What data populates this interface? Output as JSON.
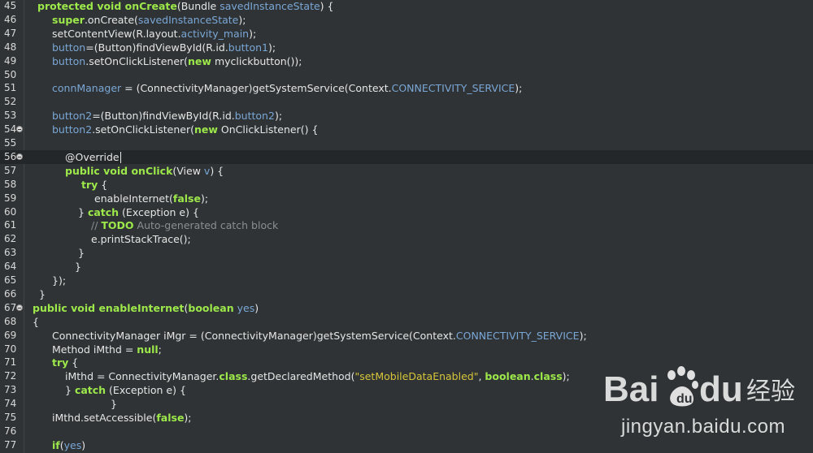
{
  "editor": {
    "current_line": "56",
    "lines": [
      {
        "num": "45",
        "fold": false,
        "indent": 16,
        "tokens": [
          {
            "t": "protected void ",
            "c": "kw"
          },
          {
            "t": "onCreate",
            "c": "kw"
          },
          {
            "t": "(Bundle ",
            "c": ""
          },
          {
            "t": "savedInstanceState",
            "c": "fld"
          },
          {
            "t": ") {",
            "c": ""
          }
        ]
      },
      {
        "num": "46",
        "fold": false,
        "indent": 34,
        "tokens": [
          {
            "t": "super",
            "c": "kw"
          },
          {
            "t": ".onCreate(",
            "c": ""
          },
          {
            "t": "savedInstanceState",
            "c": "fld"
          },
          {
            "t": ");",
            "c": ""
          }
        ]
      },
      {
        "num": "47",
        "fold": false,
        "indent": 34,
        "tokens": [
          {
            "t": "setContentView(R.layout.",
            "c": ""
          },
          {
            "t": "activity_main",
            "c": "fld"
          },
          {
            "t": ");",
            "c": ""
          }
        ]
      },
      {
        "num": "48",
        "fold": false,
        "indent": 34,
        "tokens": [
          {
            "t": "button",
            "c": "fld"
          },
          {
            "t": "=(Button)findViewById(R.id.",
            "c": ""
          },
          {
            "t": "button1",
            "c": "fld"
          },
          {
            "t": ");",
            "c": ""
          }
        ]
      },
      {
        "num": "49",
        "fold": false,
        "indent": 34,
        "tokens": [
          {
            "t": "button",
            "c": "fld"
          },
          {
            "t": ".setOnClickListener(",
            "c": ""
          },
          {
            "t": "new",
            "c": "kw"
          },
          {
            "t": " myclickbutton());",
            "c": ""
          }
        ]
      },
      {
        "num": "50",
        "fold": false,
        "indent": 34,
        "tokens": []
      },
      {
        "num": "51",
        "fold": false,
        "indent": 34,
        "tokens": [
          {
            "t": "connManager",
            "c": "fld"
          },
          {
            "t": " = (ConnectivityManager)getSystemService(Context.",
            "c": ""
          },
          {
            "t": "CONNECTIVITY_SERVICE",
            "c": "fld"
          },
          {
            "t": ");",
            "c": ""
          }
        ]
      },
      {
        "num": "52",
        "fold": false,
        "indent": 34,
        "tokens": []
      },
      {
        "num": "53",
        "fold": false,
        "indent": 34,
        "tokens": [
          {
            "t": "button2",
            "c": "fld"
          },
          {
            "t": "=(Button)findViewById(R.id.",
            "c": ""
          },
          {
            "t": "button2",
            "c": "fld"
          },
          {
            "t": ");",
            "c": ""
          }
        ]
      },
      {
        "num": "54",
        "fold": true,
        "indent": 34,
        "tokens": [
          {
            "t": "button2",
            "c": "fld"
          },
          {
            "t": ".setOnClickListener(",
            "c": ""
          },
          {
            "t": "new",
            "c": "kw"
          },
          {
            "t": " OnClickListener() {",
            "c": ""
          }
        ]
      },
      {
        "num": "55",
        "fold": false,
        "indent": 34,
        "tokens": []
      },
      {
        "num": "56",
        "fold": true,
        "indent": 50,
        "tokens": [
          {
            "t": "@Override",
            "c": "ann"
          }
        ]
      },
      {
        "num": "57",
        "fold": false,
        "indent": 50,
        "tokens": [
          {
            "t": "public void ",
            "c": "kw"
          },
          {
            "t": "onClick",
            "c": "kw"
          },
          {
            "t": "(View ",
            "c": ""
          },
          {
            "t": "v",
            "c": "fld"
          },
          {
            "t": ") {",
            "c": ""
          }
        ]
      },
      {
        "num": "58",
        "fold": false,
        "indent": 70,
        "tokens": [
          {
            "t": "try",
            "c": "kw"
          },
          {
            "t": " {",
            "c": ""
          }
        ]
      },
      {
        "num": "59",
        "fold": false,
        "indent": 86,
        "tokens": [
          {
            "t": "enableInternet(",
            "c": ""
          },
          {
            "t": "false",
            "c": "kw"
          },
          {
            "t": ");",
            "c": ""
          }
        ]
      },
      {
        "num": "60",
        "fold": false,
        "indent": 66,
        "tokens": [
          {
            "t": "} ",
            "c": ""
          },
          {
            "t": "catch",
            "c": "kw"
          },
          {
            "t": " (Exception e) {",
            "c": ""
          }
        ]
      },
      {
        "num": "61",
        "fold": false,
        "indent": 82,
        "tokens": [
          {
            "t": "// ",
            "c": "cm"
          },
          {
            "t": "TODO",
            "c": "todo"
          },
          {
            "t": " Auto-generated catch block",
            "c": "cm"
          }
        ]
      },
      {
        "num": "62",
        "fold": false,
        "indent": 82,
        "tokens": [
          {
            "t": "e.printStackTrace();",
            "c": ""
          }
        ]
      },
      {
        "num": "63",
        "fold": false,
        "indent": 66,
        "tokens": [
          {
            "t": "}",
            "c": ""
          }
        ]
      },
      {
        "num": "64",
        "fold": false,
        "indent": 62,
        "tokens": [
          {
            "t": "}",
            "c": ""
          }
        ]
      },
      {
        "num": "65",
        "fold": false,
        "indent": 34,
        "tokens": [
          {
            "t": "});",
            "c": ""
          }
        ]
      },
      {
        "num": "66",
        "fold": false,
        "indent": 18,
        "tokens": [
          {
            "t": "}",
            "c": ""
          }
        ]
      },
      {
        "num": "67",
        "fold": true,
        "indent": 10,
        "tokens": [
          {
            "t": "public void ",
            "c": "kw"
          },
          {
            "t": "enableInternet",
            "c": "kw"
          },
          {
            "t": "(",
            "c": ""
          },
          {
            "t": "boolean",
            "c": "kw"
          },
          {
            "t": " ",
            "c": ""
          },
          {
            "t": "yes",
            "c": "fld"
          },
          {
            "t": ")",
            "c": ""
          }
        ]
      },
      {
        "num": "68",
        "fold": false,
        "indent": 10,
        "tokens": [
          {
            "t": "{",
            "c": ""
          }
        ]
      },
      {
        "num": "69",
        "fold": false,
        "indent": 34,
        "tokens": [
          {
            "t": "ConnectivityManager iMgr = (ConnectivityManager)getSystemService(Context.",
            "c": ""
          },
          {
            "t": "CONNECTIVITY_SERVICE",
            "c": "fld"
          },
          {
            "t": ");",
            "c": ""
          }
        ]
      },
      {
        "num": "70",
        "fold": false,
        "indent": 34,
        "tokens": [
          {
            "t": "Method iMthd = ",
            "c": ""
          },
          {
            "t": "null",
            "c": "kw"
          },
          {
            "t": ";",
            "c": ""
          }
        ]
      },
      {
        "num": "71",
        "fold": false,
        "indent": 34,
        "tokens": [
          {
            "t": "try",
            "c": "kw"
          },
          {
            "t": " {",
            "c": ""
          }
        ]
      },
      {
        "num": "72",
        "fold": false,
        "indent": 50,
        "tokens": [
          {
            "t": "iMthd = ConnectivityManager.",
            "c": ""
          },
          {
            "t": "class",
            "c": "kw"
          },
          {
            "t": ".getDeclaredMethod(",
            "c": ""
          },
          {
            "t": "\"setMobileDataEnabled\"",
            "c": "str"
          },
          {
            "t": ", ",
            "c": ""
          },
          {
            "t": "boolean",
            "c": "kw"
          },
          {
            "t": ".",
            "c": ""
          },
          {
            "t": "class",
            "c": "kw"
          },
          {
            "t": ");",
            "c": ""
          }
        ]
      },
      {
        "num": "73",
        "fold": false,
        "indent": 50,
        "tokens": [
          {
            "t": "} ",
            "c": ""
          },
          {
            "t": "catch",
            "c": "kw"
          },
          {
            "t": " (Exception e) {",
            "c": ""
          }
        ]
      },
      {
        "num": "74",
        "fold": false,
        "indent": 106,
        "tokens": [
          {
            "t": "}",
            "c": ""
          }
        ]
      },
      {
        "num": "75",
        "fold": false,
        "indent": 34,
        "tokens": [
          {
            "t": "iMthd.setAccessible(",
            "c": ""
          },
          {
            "t": "false",
            "c": "kw"
          },
          {
            "t": ");",
            "c": ""
          }
        ]
      },
      {
        "num": "76",
        "fold": false,
        "indent": 34,
        "tokens": []
      },
      {
        "num": "77",
        "fold": false,
        "indent": 34,
        "tokens": [
          {
            "t": "if",
            "c": "kw"
          },
          {
            "t": "(",
            "c": ""
          },
          {
            "t": "yes",
            "c": "fld"
          },
          {
            "t": ")",
            "c": ""
          }
        ]
      }
    ]
  },
  "watermark": {
    "logo_text": "Bai du 经验",
    "url": "jingyan.baidu.com"
  },
  "colors": {
    "background": "#2f3335",
    "current_line": "#242729",
    "keyword": "#9de84a",
    "field": "#7aa7d6",
    "comment": "#8b8f92",
    "string": "#d7c63a",
    "text": "#e6e6e6"
  }
}
